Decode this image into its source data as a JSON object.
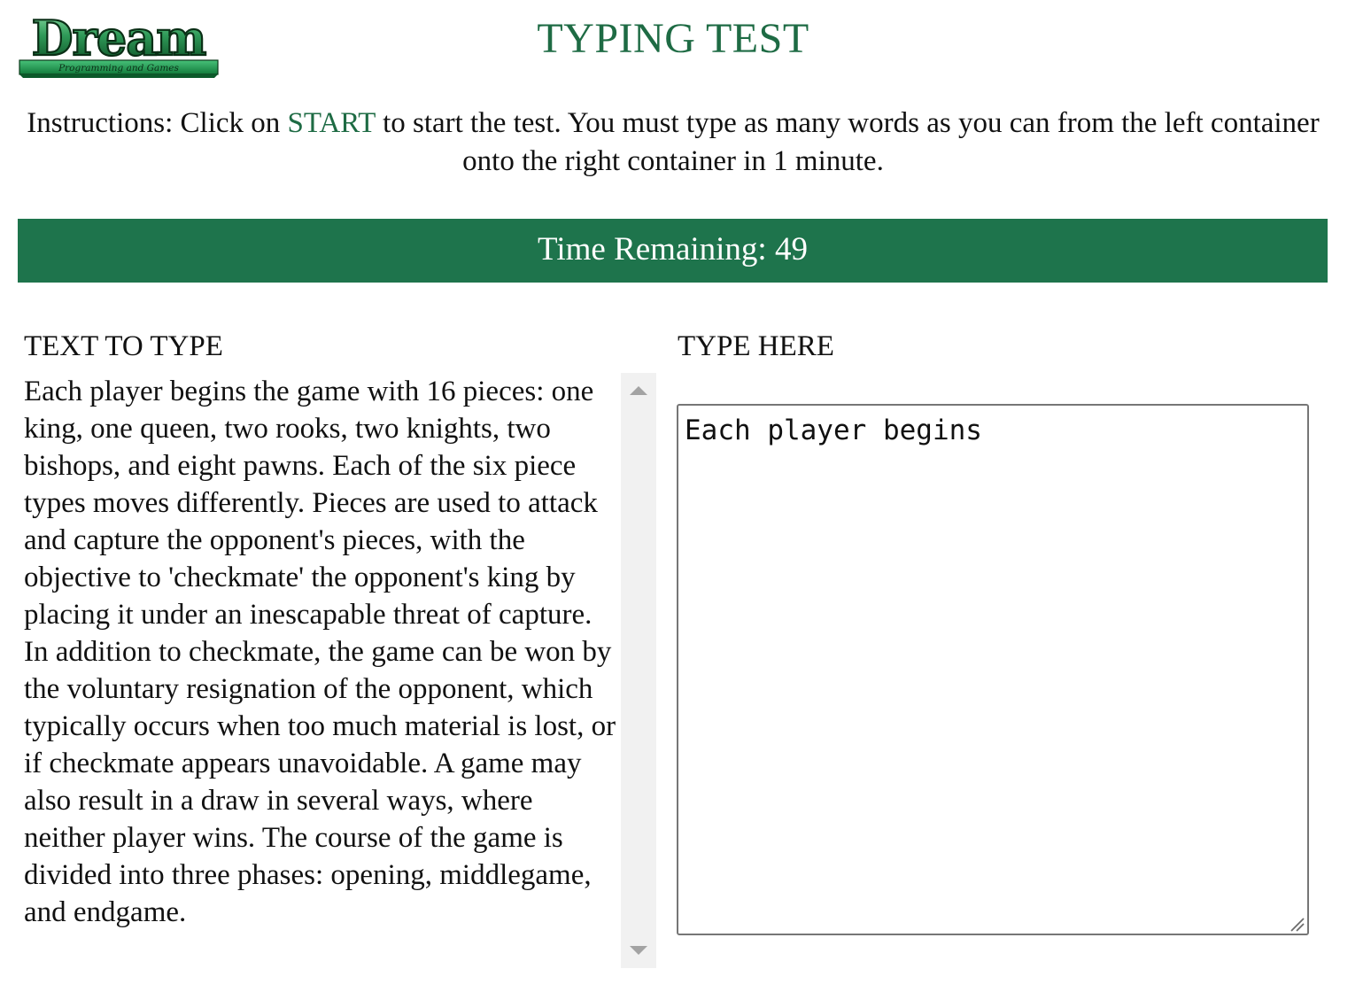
{
  "logo": {
    "main_text": "Dream",
    "tagline": "Programming and Games",
    "colors": {
      "green_dark": "#0b5a2a",
      "green_light": "#35b36a"
    }
  },
  "header": {
    "title": "TYPING TEST"
  },
  "instructions": {
    "before": "Instructions: Click on ",
    "start_link": "START",
    "after": " to start the test. You must type as many words as you can from the left container onto the right container in 1 minute."
  },
  "timer": {
    "label": "Time Remaining: ",
    "value": "49"
  },
  "source": {
    "heading": "TEXT TO TYPE",
    "text": "Each player begins the game with 16 pieces: one king, one queen, two rooks, two knights, two bishops, and eight pawns. Each of the six piece types moves differently. Pieces are used to attack and capture the opponent's pieces, with the objective to 'checkmate' the opponent's king by placing it under an inescapable threat of capture. In addition to checkmate, the game can be won by the voluntary resignation of the opponent, which typically occurs when too much material is lost, or if checkmate appears unavoidable. A game may also result in a draw in several ways, where neither player wins. The course of the game is divided into three phases: opening, middlegame, and endgame."
  },
  "input": {
    "heading": "TYPE HERE",
    "value": "Each player begins"
  },
  "colors": {
    "title": "#1e6b44",
    "timer_bar": "#1e744c",
    "scrollbar_track": "#f1f1f1"
  }
}
